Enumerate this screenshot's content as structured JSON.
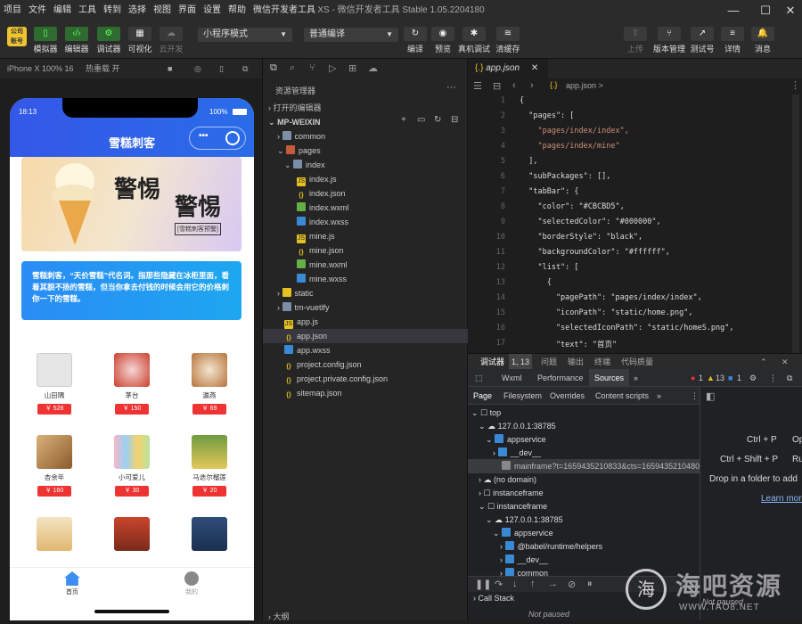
{
  "window": {
    "title": "XS - 微信开发者工具 Stable 1.05.2204180"
  },
  "menu": [
    "项目",
    "文件",
    "编辑",
    "工具",
    "转到",
    "选择",
    "视图",
    "界面",
    "设置",
    "帮助",
    "微信开发者工具"
  ],
  "toolbar": {
    "left_buttons": [
      "模拟器",
      "编辑器",
      "调试器",
      "可视化",
      "云开发"
    ],
    "mode_select": "小程序模式",
    "compile_select": "普通编译",
    "mid_buttons": [
      "编译",
      "预览",
      "真机调试",
      "清缓存"
    ],
    "right_buttons": [
      "上传",
      "版本管理",
      "测试号",
      "详情",
      "消息"
    ]
  },
  "simulator": {
    "device": "iPhone X 100% 16",
    "hot_reload": "热重载 开",
    "time": "18:13",
    "battery": "100%",
    "nav_title": "雪糕刺客",
    "banner": {
      "title1": "警惕",
      "title2": "警惕",
      "subtitle": "[雪糕刺客预警]"
    },
    "notice": "雪糕刺客，“天价雪糕”代名词。指那些隐藏在冰柜里面，看着其貌不扬的雪糕，但当你拿去付钱的时候会用它的价格刺你一下的雪糕。",
    "products": [
      {
        "name": "山田隅",
        "price": "￥ 528"
      },
      {
        "name": "茅台",
        "price": "￥ 150"
      },
      {
        "name": "瀛燕",
        "price": "￥ 69"
      },
      {
        "name": "杏余年",
        "price": "￥ 160"
      },
      {
        "name": "小可爱儿",
        "price": "￥ 30"
      },
      {
        "name": "马迭尔榴莲",
        "price": "￥ 20"
      }
    ],
    "tabs": [
      {
        "label": "首页"
      },
      {
        "label": "我的"
      }
    ]
  },
  "explorer": {
    "title": "资源管理器",
    "open_editors": "打开的编辑器",
    "project": "MP-WEIXIN",
    "outline": "大纲",
    "tree": [
      "common",
      "pages",
      "index",
      "index.js",
      "index.json",
      "index.wxml",
      "index.wxss",
      "mine.js",
      "mine.json",
      "mine.wxml",
      "mine.wxss",
      "static",
      "tm-vuetify",
      "app.js",
      "app.json",
      "app.wxss",
      "project.config.json",
      "project.private.config.json",
      "sitemap.json"
    ]
  },
  "editor": {
    "tab": "app.json",
    "breadcrumb": "app.json >",
    "lines": [
      "{",
      "  \"pages\": [",
      "    \"pages/index/index\",",
      "    \"pages/index/mine\"",
      "  ],",
      "  \"subPackages\": [],",
      "  \"tabBar\": {",
      "    \"color\": \"#CBCBD5\",",
      "    \"selectedColor\": \"#000000\",",
      "    \"borderStyle\": \"black\",",
      "    \"backgroundColor\": \"#ffffff\",",
      "    \"list\": [",
      "      {",
      "        \"pagePath\": \"pages/index/index\",",
      "        \"iconPath\": \"static/home.png\",",
      "        \"selectedIconPath\": \"static/homeS.png\",",
      "        \"text\": \"首页\""
    ]
  },
  "devtools": {
    "tabs": [
      "调试器",
      "1, 13",
      "问题",
      "输出",
      "终端",
      "代码质量"
    ],
    "subtabs": [
      "Wxml",
      "Performance",
      "Sources"
    ],
    "counts": {
      "errors": "1",
      "warnings": "13",
      "info": "1"
    },
    "nav": [
      "Page",
      "Filesystem",
      "Overrides",
      "Content scripts"
    ],
    "tree": [
      "top",
      "127.0.0.1:38785",
      "appservice",
      "__dev__",
      "mainframe?t=1659435210833&cts=1659435210480",
      "(no domain)",
      "instanceframe",
      "instanceframe",
      "127.0.0.1:38785",
      "appservice",
      "@babel/runtime/helpers",
      "__dev__",
      "common"
    ],
    "shortcuts": [
      "Ctrl + P",
      "Op",
      "Ctrl + Shift + P",
      "Ru"
    ],
    "drop_hint": "Drop in a folder to add",
    "learn_more": "Learn more",
    "call_stack": "Call Stack",
    "not_paused": "Not paused",
    "not_paused2": "Not paused"
  },
  "watermark": {
    "text": "海吧资源",
    "url": "WWW.TAO8.NET"
  }
}
